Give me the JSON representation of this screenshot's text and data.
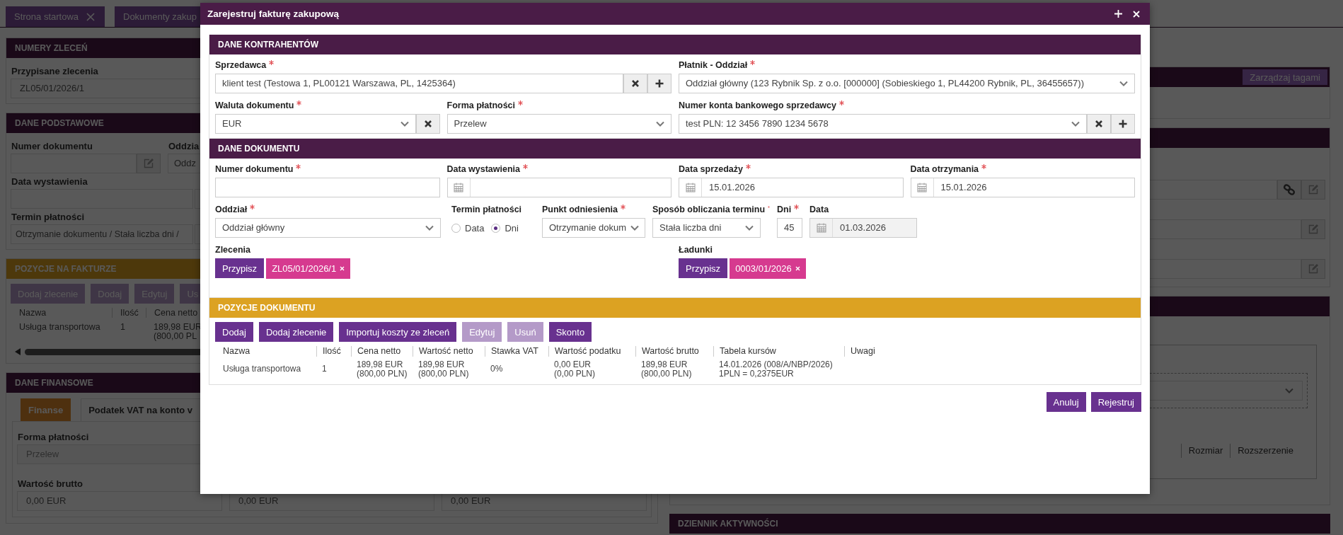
{
  "background": {
    "tabs": [
      {
        "label": "Strona startowa",
        "closable": true
      },
      {
        "label": "Dokumenty zakup"
      }
    ],
    "order_numbers": {
      "title": "NUMERY ZLECEŃ",
      "label": "Przypisane zlecenia",
      "value": "ZL05/01/2026/1"
    },
    "basic_data": {
      "title": "DANE PODSTAWOWE",
      "document_number_label": "Numer dokumentu",
      "branch_label": "Oddzia",
      "branch_value": "Oddz",
      "issue_date_label": "Data wystawienia",
      "payment_term_label": "Termin płatności",
      "payment_term_value": "Otrzymanie dokumentu / Stała liczba dni /"
    },
    "invoice_items": {
      "title": "POZYCJE NA FAKTURZE",
      "buttons": [
        "Dodaj zlecenie",
        "Dodaj",
        "Edytuj",
        "Us"
      ],
      "columns": [
        "Nazwa",
        "Ilość",
        "Cena netto"
      ],
      "rows": [
        [
          [
            "Usługa transportowa"
          ],
          [
            "1"
          ],
          [
            "189,98 EUR",
            "(800,00 PL"
          ]
        ]
      ]
    },
    "financial": {
      "title": "DANE FINANSOWE",
      "tabs": [
        {
          "label": "Finanse",
          "selected": true
        },
        {
          "label": "Podatek VAT na konto v",
          "selected": false
        }
      ],
      "payment_form_label": "Forma płatności",
      "payment_form_value": "Przelew",
      "gross_label": "Wartość brutto",
      "gross_values": [
        "0,00 EUR",
        "0,00 EUR",
        "0,00 EUR"
      ]
    },
    "tags_button": "Zarządzaj tagami",
    "attachment_columns": [
      "Rozmiar",
      "Rozszerzenie"
    ],
    "activity_title": "DZIENNIK AKTYWNOŚCI"
  },
  "modal": {
    "title": "Zarejestruj fakturę zakupową",
    "parties": {
      "title": "DANE KONTRAHENTÓW",
      "seller": {
        "label": "Sprzedawca",
        "required": true,
        "value": "klient test (Testowa 1, PL00121 Warszawa, PL, 1425364)"
      },
      "payer": {
        "label": "Płatnik - Oddział",
        "required": true,
        "value": "Oddział główny (123 Rybnik Sp. z o.o. [000000] (Sobieskiego 1, PL44200 Rybnik, PL, 36455657))"
      },
      "currency": {
        "label": "Waluta dokumentu",
        "required": true,
        "value": "EUR"
      },
      "payment_form": {
        "label": "Forma płatności",
        "required": true,
        "value": "Przelew"
      },
      "bank_account": {
        "label": "Numer konta bankowego sprzedawcy",
        "required": true,
        "value": "test PLN: 12 3456 7890 1234 5678"
      }
    },
    "document": {
      "title": "DANE DOKUMENTU",
      "number": {
        "label": "Numer dokumentu",
        "required": true
      },
      "issue_date": {
        "label": "Data wystawienia",
        "required": true
      },
      "sale_date": {
        "label": "Data sprzedaży",
        "required": true,
        "value": "15.01.2026"
      },
      "receipt_date": {
        "label": "Data otrzymania",
        "required": true,
        "value": "15.01.2026"
      },
      "branch": {
        "label": "Oddział",
        "required": true,
        "value": "Oddział główny"
      },
      "payment_term": {
        "label": "Termin płatności",
        "required": false,
        "options": [
          {
            "label": "Data",
            "selected": false
          },
          {
            "label": "Dni",
            "selected": true
          }
        ]
      },
      "reference_point": {
        "label": "Punkt odniesienia",
        "required": true,
        "value": "Otrzymanie dokum"
      },
      "calculation_method": {
        "label": "Sposób obliczania terminu",
        "required": true,
        "value": "Stała liczba dni"
      },
      "days": {
        "label": "Dni",
        "required": true,
        "value": "45"
      },
      "due_date": {
        "label": "Data",
        "required": false,
        "readonly": true,
        "value": "01.03.2026"
      },
      "orders": {
        "label": "Zlecenia",
        "button": "Przypisz",
        "tags": [
          "ZL05/01/2026/1"
        ]
      },
      "loads": {
        "label": "Ładunki",
        "button": "Przypisz",
        "tags": [
          "0003/01/2026"
        ]
      }
    },
    "items": {
      "title": "POZYCJE DOKUMENTU",
      "buttons": [
        {
          "label": "Dodaj",
          "disabled": false
        },
        {
          "label": "Dodaj zlecenie",
          "disabled": false
        },
        {
          "label": "Importuj koszty ze zleceń",
          "disabled": false
        },
        {
          "label": "Edytuj",
          "disabled": true
        },
        {
          "label": "Usuń",
          "disabled": true
        },
        {
          "label": "Skonto",
          "disabled": false
        }
      ],
      "columns": [
        "Nazwa",
        "Ilość",
        "Cena netto",
        "Wartość netto",
        "Stawka VAT",
        "Wartość podatku",
        "Wartość brutto",
        "Tabela kursów",
        "Uwagi"
      ],
      "rows": [
        [
          [
            "Usługa transportowa"
          ],
          [
            "1"
          ],
          [
            "189,98 EUR",
            "(800,00 PLN)"
          ],
          [
            "189,98 EUR",
            "(800,00 PLN)"
          ],
          [
            "0%"
          ],
          [
            "0,00 EUR",
            "(0,00 PLN)"
          ],
          [
            "189,98 EUR",
            "(800,00 PLN)"
          ],
          [
            "14.01.2026 (008/A/NBP/2026)",
            "1PLN = 0,2375EUR"
          ]
        ]
      ]
    },
    "footer_buttons": [
      "Anuluj",
      "Rejestruj"
    ]
  }
}
